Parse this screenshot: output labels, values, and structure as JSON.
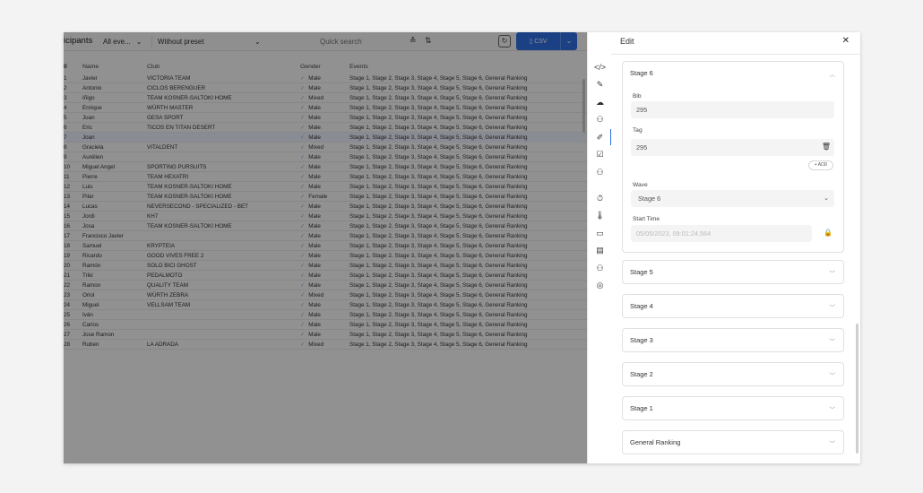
{
  "toolbar": {
    "title": "icipants",
    "filter_all": "All eve...",
    "preset": "Without preset",
    "search_placeholder": "Quick search",
    "csv_label": "CSV"
  },
  "table": {
    "headers": {
      "num": "0",
      "name": "Name",
      "club": "Club",
      "gender": "Gender",
      "events": "Events"
    },
    "rows": [
      {
        "num": "1",
        "name": "Javier",
        "club": "VICTORIA TEAM",
        "gender": "Male",
        "events": "Stage 1, Stage 2, Stage 3, Stage 4, Stage 5, Stage 6, General Ranking"
      },
      {
        "num": "2",
        "name": "Antonio",
        "club": "CICLOS BERENGUER",
        "gender": "Male",
        "events": "Stage 1, Stage 2, Stage 3, Stage 4, Stage 5, Stage 6, General Ranking"
      },
      {
        "num": "3",
        "name": "Iñigo",
        "club": "TEAM KOSNER-SALTOKI HOME",
        "gender": "Mixed",
        "events": "Stage 1, Stage 2, Stage 3, Stage 4, Stage 5, Stage 6, General Ranking"
      },
      {
        "num": "4",
        "name": "Enrique",
        "club": "WÜRTH MASTER",
        "gender": "Male",
        "events": "Stage 1, Stage 2, Stage 3, Stage 4, Stage 5, Stage 6, General Ranking"
      },
      {
        "num": "5",
        "name": "Juan",
        "club": "GESA SPORT",
        "gender": "Male",
        "events": "Stage 1, Stage 2, Stage 3, Stage 4, Stage 5, Stage 6, General Ranking"
      },
      {
        "num": "6",
        "name": "Eric",
        "club": "TICOS EN TITAN DESERT",
        "gender": "Male",
        "events": "Stage 1, Stage 2, Stage 3, Stage 4, Stage 5, Stage 6, General Ranking"
      },
      {
        "num": "7",
        "name": "Joan",
        "club": "",
        "gender": "Male",
        "events": "Stage 1, Stage 2, Stage 3, Stage 4, Stage 5, Stage 6, General Ranking"
      },
      {
        "num": "8",
        "name": "Graciela",
        "club": "VITALDENT",
        "gender": "Mixed",
        "events": "Stage 1, Stage 2, Stage 3, Stage 4, Stage 5, Stage 6, General Ranking"
      },
      {
        "num": "9",
        "name": "Aurélien",
        "club": "",
        "gender": "Male",
        "events": "Stage 1, Stage 2, Stage 3, Stage 4, Stage 5, Stage 6, General Ranking"
      },
      {
        "num": "10",
        "name": "Miguel Angel",
        "club": "SPORTING PURSUITS",
        "gender": "Male",
        "events": "Stage 1, Stage 2, Stage 3, Stage 4, Stage 5, Stage 6, General Ranking"
      },
      {
        "num": "11",
        "name": "Pierre",
        "club": "TEAM HEXATRI",
        "gender": "Male",
        "events": "Stage 1, Stage 2, Stage 3, Stage 4, Stage 5, Stage 6, General Ranking"
      },
      {
        "num": "12",
        "name": "Luis",
        "club": "TEAM KOSNER-SALTOKI HOME",
        "gender": "Male",
        "events": "Stage 1, Stage 2, Stage 3, Stage 4, Stage 5, Stage 6, General Ranking"
      },
      {
        "num": "13",
        "name": "Pilar",
        "club": "TEAM KOSNER-SALTOKI HOME",
        "gender": "Female",
        "events": "Stage 1, Stage 2, Stage 3, Stage 4, Stage 5, Stage 6, General Ranking"
      },
      {
        "num": "14",
        "name": "Lucas",
        "club": "NEVERSECOND - SPECIALIZED - BET",
        "gender": "Male",
        "events": "Stage 1, Stage 2, Stage 3, Stage 4, Stage 5, Stage 6, General Ranking"
      },
      {
        "num": "15",
        "name": "Jordi",
        "club": "KH7",
        "gender": "Male",
        "events": "Stage 1, Stage 2, Stage 3, Stage 4, Stage 5, Stage 6, General Ranking"
      },
      {
        "num": "16",
        "name": "Josa",
        "club": "TEAM KOSNER-SALTOKI HOME",
        "gender": "Male",
        "events": "Stage 1, Stage 2, Stage 3, Stage 4, Stage 5, Stage 6, General Ranking"
      },
      {
        "num": "17",
        "name": "Francisco Javier",
        "club": "",
        "gender": "Male",
        "events": "Stage 1, Stage 2, Stage 3, Stage 4, Stage 5, Stage 6, General Ranking"
      },
      {
        "num": "18",
        "name": "Samuel",
        "club": "KRYPTEIA",
        "gender": "Male",
        "events": "Stage 1, Stage 2, Stage 3, Stage 4, Stage 5, Stage 6, General Ranking"
      },
      {
        "num": "19",
        "name": "Ricardo",
        "club": "GOOD VIVES FREE 2",
        "gender": "Male",
        "events": "Stage 1, Stage 2, Stage 3, Stage 4, Stage 5, Stage 6, General Ranking"
      },
      {
        "num": "20",
        "name": "Ramón",
        "club": "SOLO BICI GHOST",
        "gender": "Male",
        "events": "Stage 1, Stage 2, Stage 3, Stage 4, Stage 5, Stage 6, General Ranking"
      },
      {
        "num": "21",
        "name": "Triki",
        "club": "PEDALMOTO",
        "gender": "Male",
        "events": "Stage 1, Stage 2, Stage 3, Stage 4, Stage 5, Stage 6, General Ranking"
      },
      {
        "num": "22",
        "name": "Ramon",
        "club": "QUALITY TEAM",
        "gender": "Male",
        "events": "Stage 1, Stage 2, Stage 3, Stage 4, Stage 5, Stage 6, General Ranking"
      },
      {
        "num": "23",
        "name": "Oriol",
        "club": "WÜRTH ZEBRA",
        "gender": "Mixed",
        "events": "Stage 1, Stage 2, Stage 3, Stage 4, Stage 5, Stage 6, General Ranking"
      },
      {
        "num": "24",
        "name": "Miguel",
        "club": "VELLSAM TEAM",
        "gender": "Male",
        "events": "Stage 1, Stage 2, Stage 3, Stage 4, Stage 5, Stage 6, General Ranking"
      },
      {
        "num": "25",
        "name": "Iván",
        "club": "",
        "gender": "Male",
        "events": "Stage 1, Stage 2, Stage 3, Stage 4, Stage 5, Stage 6, General Ranking"
      },
      {
        "num": "26",
        "name": "Carlos",
        "club": "",
        "gender": "Male",
        "events": "Stage 1, Stage 2, Stage 3, Stage 4, Stage 5, Stage 6, General Ranking"
      },
      {
        "num": "27",
        "name": "Jose Ramon",
        "club": "",
        "gender": "Male",
        "events": "Stage 1, Stage 2, Stage 3, Stage 4, Stage 5, Stage 6, General Ranking"
      },
      {
        "num": "28",
        "name": "Ruben",
        "club": "LA ADRADA",
        "gender": "Mixed",
        "events": "Stage 1, Stage 2, Stage 3, Stage 4, Stage 5, Stage 6, General Ranking"
      }
    ]
  },
  "edit": {
    "title": "Edit",
    "stage6": {
      "title": "Stage 6",
      "bib_label": "Bib",
      "bib_value": "295",
      "tag_label": "Tag",
      "tag_value": "295",
      "add_label": "+ ADD",
      "wave_label": "Wave",
      "wave_value": "Stage 6",
      "start_label": "Start Time",
      "start_value": "05/05/2023, 09:01:24,564"
    },
    "collapsed": [
      "Stage 5",
      "Stage 4",
      "Stage 3",
      "Stage 2",
      "Stage 1",
      "General Ranking"
    ]
  },
  "colors": {
    "accent": "#2f6fe4",
    "overlay": "rgba(0,0,0,0.42)"
  }
}
